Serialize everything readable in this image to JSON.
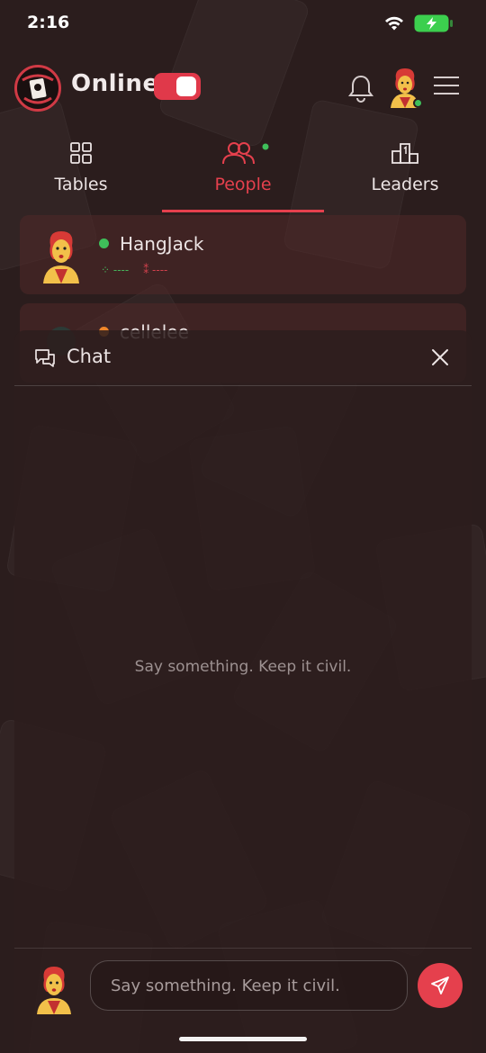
{
  "status_bar": {
    "time": "2:16"
  },
  "header": {
    "online_label": "Online",
    "online_toggle_on": true
  },
  "tabs": [
    {
      "label": "Tables",
      "icon": "grid-icon",
      "active": false
    },
    {
      "label": "People",
      "icon": "people-icon",
      "active": true
    },
    {
      "label": "Leaders",
      "icon": "podium-icon",
      "active": false
    }
  ],
  "people": [
    {
      "name": "HangJack",
      "status": "online",
      "status_color": "#3fbf5a",
      "stat_wins": "----",
      "stat_losses": "----"
    },
    {
      "name": "cellelee",
      "status": "away",
      "status_color": "#f0862a",
      "stat_wins": "",
      "stat_losses": ""
    }
  ],
  "chat": {
    "title": "Chat",
    "empty_message": "Say something. Keep it civil.",
    "input_placeholder": "Say something. Keep it civil.",
    "input_value": ""
  },
  "colors": {
    "accent": "#e5404d",
    "online": "#3fbf5a",
    "background": "#2b1d1d"
  }
}
